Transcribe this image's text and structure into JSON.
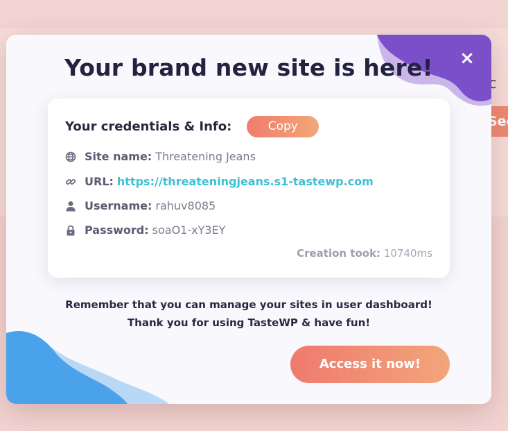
{
  "background": {
    "partial_text": "t c",
    "partial_button": "See"
  },
  "modal": {
    "title": "Your brand new site is here!",
    "close_label": "×",
    "credentials": {
      "heading": "Your credentials & Info:",
      "copy_label": "Copy",
      "site_name_label": "Site name:",
      "site_name_value": "Threatening Jeans",
      "url_label": "URL:",
      "url_value": "https://threateningjeans.s1-tastewp.com",
      "username_label": "Username:",
      "username_value": "rahuv8085",
      "password_label": "Password:",
      "password_value": "soaO1-xY3EY",
      "creation_label": "Creation took:",
      "creation_value": "10740ms"
    },
    "message_line1": "Remember that you can manage your sites in user dashboard!",
    "message_line2": "Thank you for using TasteWP & have fun!",
    "access_label": "Access it now!"
  },
  "icons": {
    "site": "globe-icon",
    "url": "link-icon",
    "user": "user-icon",
    "password": "lock-icon"
  },
  "colors": {
    "accent_gradient_start": "#ef7c6e",
    "accent_gradient_end": "#f2a877",
    "link": "#3ec0d3",
    "blob_purple": "#7b4fc9",
    "blob_blue": "#4aa3ea"
  }
}
